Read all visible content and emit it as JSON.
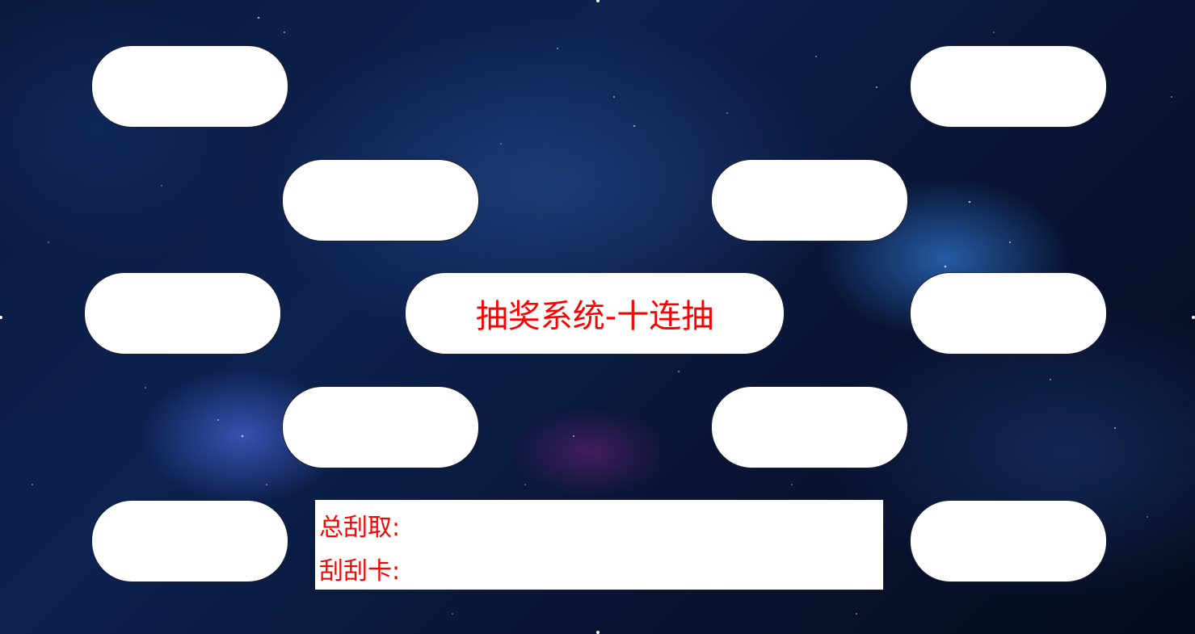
{
  "title": "抽奖系统-十连抽",
  "info": {
    "total_label": "总刮取:",
    "total_value": "",
    "card_label": "刮刮卡:",
    "card_value": ""
  },
  "slots": [
    "",
    "",
    "",
    "",
    "",
    "",
    "",
    "",
    "",
    ""
  ],
  "colors": {
    "accent_text": "#ff0000",
    "card_background": "#ffffff",
    "page_background": "#0c2250"
  }
}
